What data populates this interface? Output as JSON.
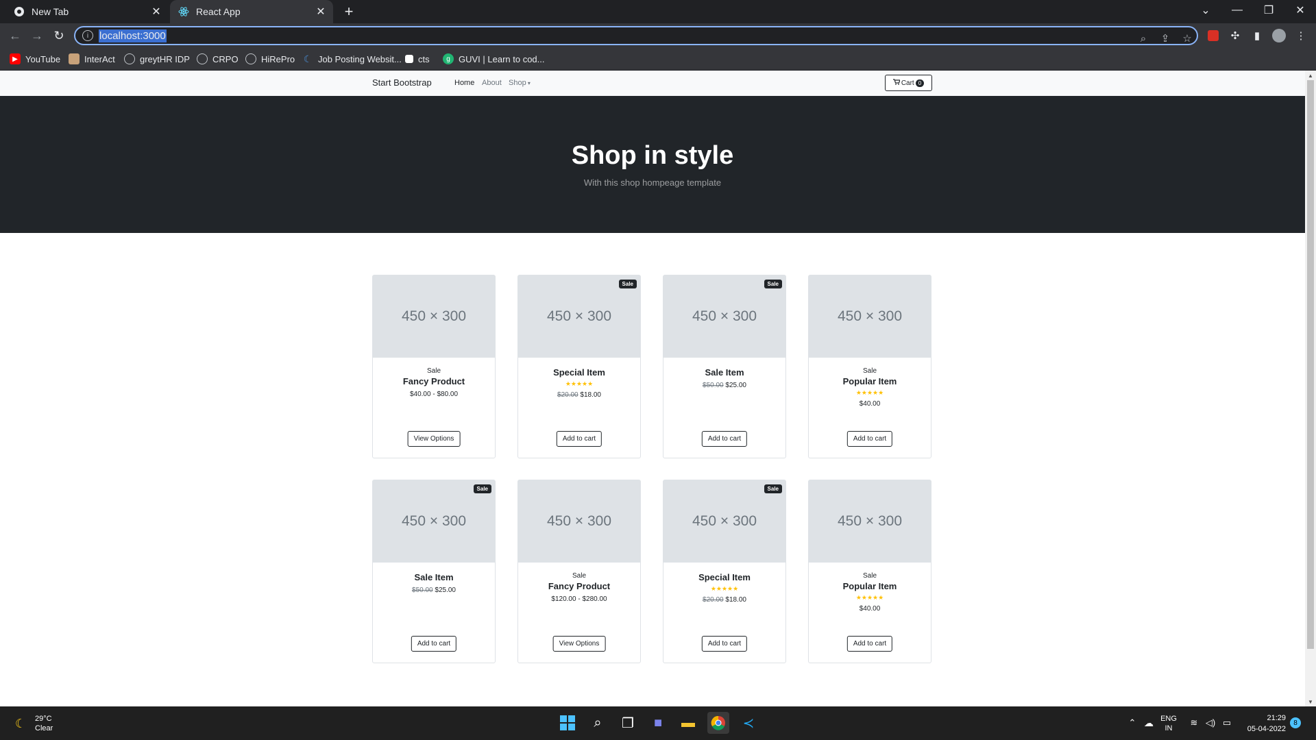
{
  "browser": {
    "tabs": [
      {
        "title": "New Tab",
        "icon": "chrome-icon",
        "active": false
      },
      {
        "title": "React App",
        "icon": "react-icon",
        "active": true
      }
    ],
    "url": "localhost:3000",
    "bookmarks": [
      {
        "label": "YouTube",
        "icon": "youtube-icon"
      },
      {
        "label": "InterAct",
        "icon": "interact-icon"
      },
      {
        "label": "greytHR IDP",
        "icon": "globe-icon"
      },
      {
        "label": "CRPO",
        "icon": "globe-icon"
      },
      {
        "label": "HiRePro",
        "icon": "globe-icon"
      },
      {
        "label": "Job Posting Websit...",
        "icon": "job-posting-icon"
      },
      {
        "label": "cts",
        "icon": "cts-icon"
      },
      {
        "label": "GUVI | Learn to cod...",
        "icon": "guvi-icon"
      }
    ]
  },
  "site": {
    "brand": "Start Bootstrap",
    "nav": {
      "home": "Home",
      "about": "About",
      "shop": "Shop"
    },
    "cart": {
      "label": "Cart",
      "count": "0"
    },
    "hero": {
      "title": "Shop in style",
      "subtitle": "With this shop hompeage template"
    },
    "placeholder": "450 × 300",
    "sale_badge": "Sale",
    "stars": "★★★★★",
    "products": [
      {
        "tag": "Sale",
        "name": "Fancy Product",
        "old_price": "",
        "price": "$40.00 - $80.00",
        "rating": 0,
        "sale_badge": false,
        "button": "View Options"
      },
      {
        "tag": "",
        "name": "Special Item",
        "old_price": "$20.00",
        "price": "$18.00",
        "rating": 5,
        "sale_badge": true,
        "button": "Add to cart"
      },
      {
        "tag": "",
        "name": "Sale Item",
        "old_price": "$50.00",
        "price": "$25.00",
        "rating": 0,
        "sale_badge": true,
        "button": "Add to cart"
      },
      {
        "tag": "Sale",
        "name": "Popular Item",
        "old_price": "",
        "price": "$40.00",
        "rating": 5,
        "sale_badge": false,
        "button": "Add to cart"
      },
      {
        "tag": "",
        "name": "Sale Item",
        "old_price": "$50.00",
        "price": "$25.00",
        "rating": 0,
        "sale_badge": true,
        "button": "Add to cart"
      },
      {
        "tag": "Sale",
        "name": "Fancy Product",
        "old_price": "",
        "price": "$120.00 - $280.00",
        "rating": 0,
        "sale_badge": false,
        "button": "View Options"
      },
      {
        "tag": "",
        "name": "Special Item",
        "old_price": "$20.00",
        "price": "$18.00",
        "rating": 5,
        "sale_badge": true,
        "button": "Add to cart"
      },
      {
        "tag": "Sale",
        "name": "Popular Item",
        "old_price": "",
        "price": "$40.00",
        "rating": 5,
        "sale_badge": false,
        "button": "Add to cart"
      }
    ]
  },
  "taskbar": {
    "weather": {
      "temp": "29°C",
      "condition": "Clear"
    },
    "language": {
      "line1": "ENG",
      "line2": "IN"
    },
    "time": "21:29",
    "date": "05-04-2022",
    "notifications": "8"
  },
  "colors": {
    "accent": "#8ab4f8",
    "dark": "#212529",
    "star": "#ffc107"
  }
}
